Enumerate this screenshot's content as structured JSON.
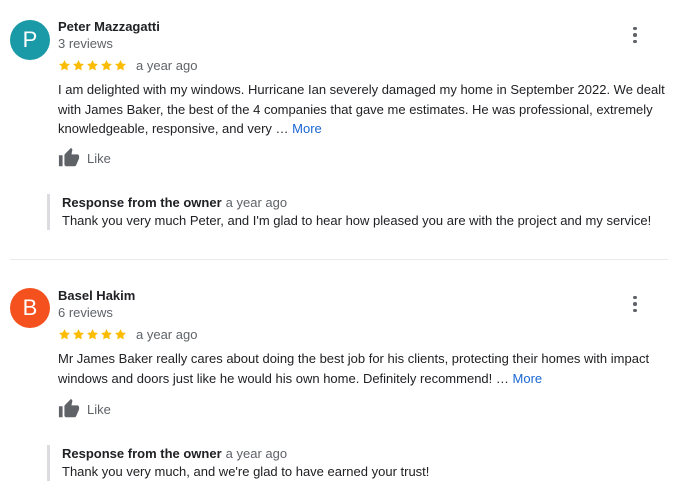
{
  "reviews": [
    {
      "avatar_letter": "P",
      "avatar_color": "#1a9aa7",
      "name": "Peter Mazzagatti",
      "review_count": "3 reviews",
      "stars": 5,
      "time": "a year ago",
      "text": "I am delighted with my windows. Hurricane Ian severely damaged my home in September 2022. We dealt with James Baker, the best of the 4 companies that gave me estimates. He was professional, extremely knowledgeable, responsive, and very …",
      "more_label": "More",
      "like_label": "Like",
      "response_title": "Response from the owner",
      "response_time": "a year ago",
      "response_text": "Thank you very much Peter, and I'm glad to hear how pleased you are with the project and my service!"
    },
    {
      "avatar_letter": "B",
      "avatar_color": "#f4511e",
      "name": "Basel Hakim",
      "review_count": "6 reviews",
      "stars": 5,
      "time": "a year ago",
      "text": "Mr James Baker really cares about doing the best job for his clients, protecting their homes with impact windows and doors just like he would his own home. Definitely recommend! …",
      "more_label": "More",
      "like_label": "Like",
      "response_title": "Response from the owner",
      "response_time": "a year ago",
      "response_text": "Thank you very much, and we're glad to have earned your trust!"
    }
  ],
  "colors": {
    "star": "#fbbc04",
    "link": "#1967d2",
    "muted": "#5f6368"
  },
  "icons": {
    "menu": "more-vert-icon",
    "like": "thumb-up-icon",
    "star": "star-icon"
  }
}
